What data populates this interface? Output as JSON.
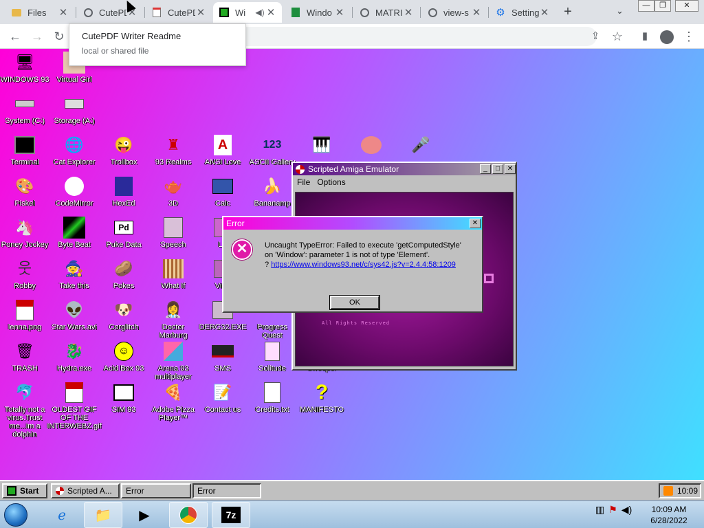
{
  "browser": {
    "tabs": [
      {
        "title": "Files",
        "icon": "folder-icon"
      },
      {
        "title": "CutePD",
        "icon": "chrome-globe-icon"
      },
      {
        "title": "CutePD",
        "icon": "pdf-icon"
      },
      {
        "title": "Wi",
        "icon": "windows93-icon",
        "active": true
      },
      {
        "title": "Windo",
        "icon": "sheets-icon"
      },
      {
        "title": "MATRI",
        "icon": "globe-icon"
      },
      {
        "title": "view-s",
        "icon": "globe-icon"
      },
      {
        "title": "Setting",
        "icon": "gear-icon"
      }
    ],
    "new_tab": "+",
    "tooltip": {
      "title": "CutePDF Writer Readme",
      "subtitle": "local or shared file"
    }
  },
  "desktop_icons": [
    {
      "label": "WINDOWS 93",
      "icon": "computer-icon"
    },
    {
      "label": "Virtual Girl",
      "icon": "girl-icon"
    },
    {
      "label": "System (C:)",
      "icon": "drive-icon"
    },
    {
      "label": "Storage (A:)",
      "icon": "floppy-icon"
    },
    {
      "label": "Terminal",
      "icon": "terminal-icon"
    },
    {
      "label": "Cat Explorer",
      "icon": "cat-globe-icon"
    },
    {
      "label": "Trollbox",
      "icon": "trollbox-icon"
    },
    {
      "label": "93 Realms",
      "icon": "realms-icon"
    },
    {
      "label": "ANSI Love",
      "icon": "ansi-icon"
    },
    {
      "label": "ASCII Gallery",
      "icon": "ascii-icon"
    },
    {
      "label": "Piskel",
      "icon": "palette-icon"
    },
    {
      "label": "CodeMirror",
      "icon": "codemirror-icon"
    },
    {
      "label": "HexEd",
      "icon": "cube-icon"
    },
    {
      "label": "3D",
      "icon": "teapot-icon"
    },
    {
      "label": "Calc",
      "icon": "calc-icon"
    },
    {
      "label": "Bananamp",
      "icon": "banana-icon"
    },
    {
      "label": "Poney Jockey",
      "icon": "pony-icon"
    },
    {
      "label": "Byte Beat",
      "icon": "bytebeat-icon"
    },
    {
      "label": "Puke Data",
      "icon": "pd-icon"
    },
    {
      "label": "Speech",
      "icon": "face-icon"
    },
    {
      "label": "LS",
      "icon": "ls-icon"
    },
    {
      "label": "Robby",
      "icon": "stickman-icon"
    },
    {
      "label": "Take this",
      "icon": "takethis-icon"
    },
    {
      "label": "Pokes",
      "icon": "pokes-icon"
    },
    {
      "label": "What If",
      "icon": "whatif-icon"
    },
    {
      "label": "Virtu",
      "icon": "virtual-icon"
    },
    {
      "label": "lenna.png",
      "icon": "image-file-icon"
    },
    {
      "label": "Star Wars.avi",
      "icon": "yoda-icon"
    },
    {
      "label": "Corglitch",
      "icon": "corgi-icon"
    },
    {
      "label": "Doctor Marburg",
      "icon": "doctor-icon"
    },
    {
      "label": "DERG32.EXE",
      "icon": "derg-icon"
    },
    {
      "label": "Progress Quest",
      "icon": "progress-icon"
    },
    {
      "label": "TRASH",
      "icon": "trash-icon"
    },
    {
      "label": "Hydra.exe",
      "icon": "hydra-icon"
    },
    {
      "label": "Acid Box 93",
      "icon": "smiley-icon"
    },
    {
      "label": "Arena 93 multiplayer",
      "icon": "arena-icon"
    },
    {
      "label": "SMS",
      "icon": "sms-icon"
    },
    {
      "label": "Solitude",
      "icon": "solitude-icon"
    },
    {
      "label": "Sweeper",
      "icon": "sweeper-icon"
    },
    {
      "label": "Totally not a virus.Trust me...im a dolphin",
      "icon": "dolphin-icon"
    },
    {
      "label": "OLDEST GIF OF THE INTERWEBZ.gif",
      "icon": "gif-file-icon"
    },
    {
      "label": "SIM 93",
      "icon": "sim-icon"
    },
    {
      "label": "Adobe Pizza Player™",
      "icon": "pizza-icon"
    },
    {
      "label": "Contact us",
      "icon": "contact-icon"
    },
    {
      "label": "Credits.txt",
      "icon": "text-file-icon"
    },
    {
      "label": "MANIFESTO",
      "icon": "question-icon"
    }
  ],
  "amiga_window": {
    "title": "Scripted Amiga Emulator",
    "menu": [
      "File",
      "Options"
    ],
    "screen_text": "All Rights Reserved"
  },
  "error_dialog": {
    "title": "Error",
    "message": "Uncaught TypeError: Failed to execute 'getComputedStyle' on 'Window': parameter 1 is not of type 'Element'.",
    "link_prefix": "?",
    "link": "https://www.windows93.net/c/sys42.js?v=2.4.4:58:1209",
    "ok_label": "OK"
  },
  "w93_taskbar": {
    "start_label": "Start",
    "buttons": [
      "Scripted A...",
      "Error",
      "Error"
    ],
    "clock": "10:09"
  },
  "win_taskbar": {
    "time": "10:09 AM",
    "date": "6/28/2022"
  }
}
